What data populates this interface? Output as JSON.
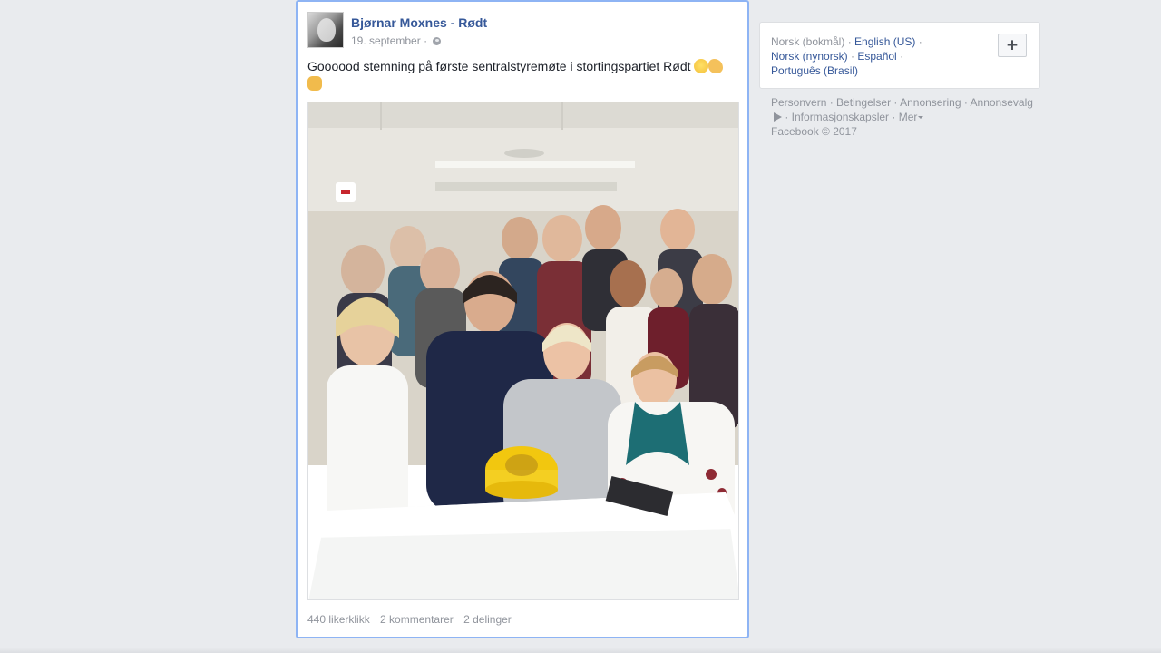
{
  "post": {
    "author": "Bjørnar Moxnes - Rødt",
    "date": "19. september",
    "separator": "·",
    "text": "Goooood stemning på første sentralstyremøte i stortingspartiet Rødt",
    "emojis": [
      "smiling-face-icon",
      "flexed-biceps-icon",
      "raised-fist-icon"
    ],
    "stats": {
      "likes": "440 likerklikk",
      "comments": "2 kommentarer",
      "shares": "2 delinger"
    }
  },
  "sidebar": {
    "current_language": "Norsk (bokmål)",
    "languages": [
      "English (US)",
      "Norsk (nynorsk)",
      "Español",
      "Português (Brasil)"
    ],
    "add_language_label": "+"
  },
  "footer": {
    "links": [
      "Personvern",
      "Betingelser",
      "Annonsering",
      "Annonsevalg",
      "Informasjonskapsler",
      "Mer"
    ],
    "copyright": "Facebook © 2017"
  },
  "colors": {
    "link": "#365899",
    "muted": "#90949c",
    "background": "#e9ebee",
    "focus_border": "#8eb4f4"
  }
}
